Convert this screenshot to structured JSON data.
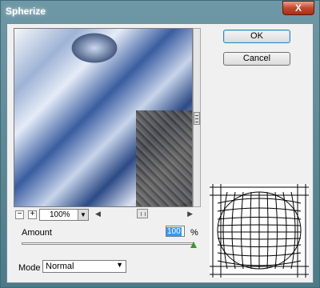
{
  "window": {
    "title": "Spherize",
    "close_glyph": "X"
  },
  "buttons": {
    "ok": "OK",
    "cancel": "Cancel"
  },
  "zoom": {
    "value": "100%",
    "minus": "−",
    "plus": "+"
  },
  "amount": {
    "label": "Amount",
    "value": "100",
    "unit": "%",
    "slider_level_percent": 100
  },
  "mode": {
    "label": "Mode",
    "selected": "Normal"
  },
  "icons": {
    "dropdown": "chevron-down-icon",
    "close": "close-icon"
  }
}
